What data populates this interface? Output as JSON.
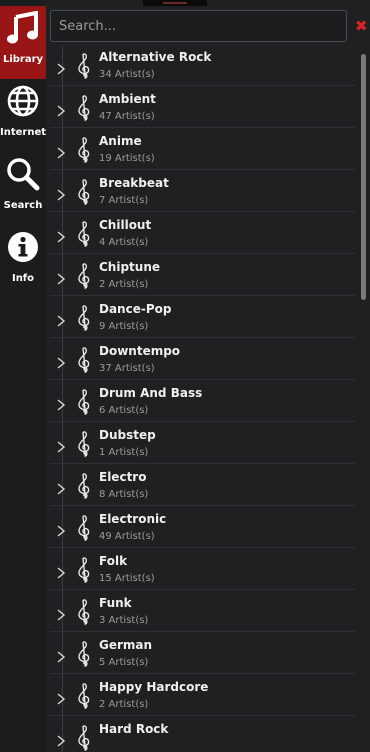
{
  "sidebar": {
    "items": [
      {
        "label": "Library",
        "icon": "music-note-icon",
        "active": true
      },
      {
        "label": "Internet",
        "icon": "globe-icon",
        "active": false
      },
      {
        "label": "Search",
        "icon": "magnifier-icon",
        "active": false
      },
      {
        "label": "Info",
        "icon": "info-icon",
        "active": false
      }
    ]
  },
  "search": {
    "placeholder": "Search...",
    "value": "",
    "clear_symbol": "✖"
  },
  "colors": {
    "accent": "#9a1515",
    "clear": "#dd2222",
    "background": "#1f2022"
  },
  "genres": [
    {
      "name": "Alternative Rock",
      "count": "34 Artist(s)"
    },
    {
      "name": "Ambient",
      "count": "47 Artist(s)"
    },
    {
      "name": "Anime",
      "count": "19 Artist(s)"
    },
    {
      "name": "Breakbeat",
      "count": "7 Artist(s)"
    },
    {
      "name": "Chillout",
      "count": "4 Artist(s)"
    },
    {
      "name": "Chiptune",
      "count": "2 Artist(s)"
    },
    {
      "name": "Dance-Pop",
      "count": "9 Artist(s)"
    },
    {
      "name": "Downtempo",
      "count": "37 Artist(s)"
    },
    {
      "name": "Drum And Bass",
      "count": "6 Artist(s)"
    },
    {
      "name": "Dubstep",
      "count": "1 Artist(s)"
    },
    {
      "name": "Electro",
      "count": "8 Artist(s)"
    },
    {
      "name": "Electronic",
      "count": "49 Artist(s)"
    },
    {
      "name": "Folk",
      "count": "15 Artist(s)"
    },
    {
      "name": "Funk",
      "count": "3 Artist(s)"
    },
    {
      "name": "German",
      "count": "5 Artist(s)"
    },
    {
      "name": "Happy Hardcore",
      "count": "2 Artist(s)"
    },
    {
      "name": "Hard Rock",
      "count": ""
    }
  ]
}
